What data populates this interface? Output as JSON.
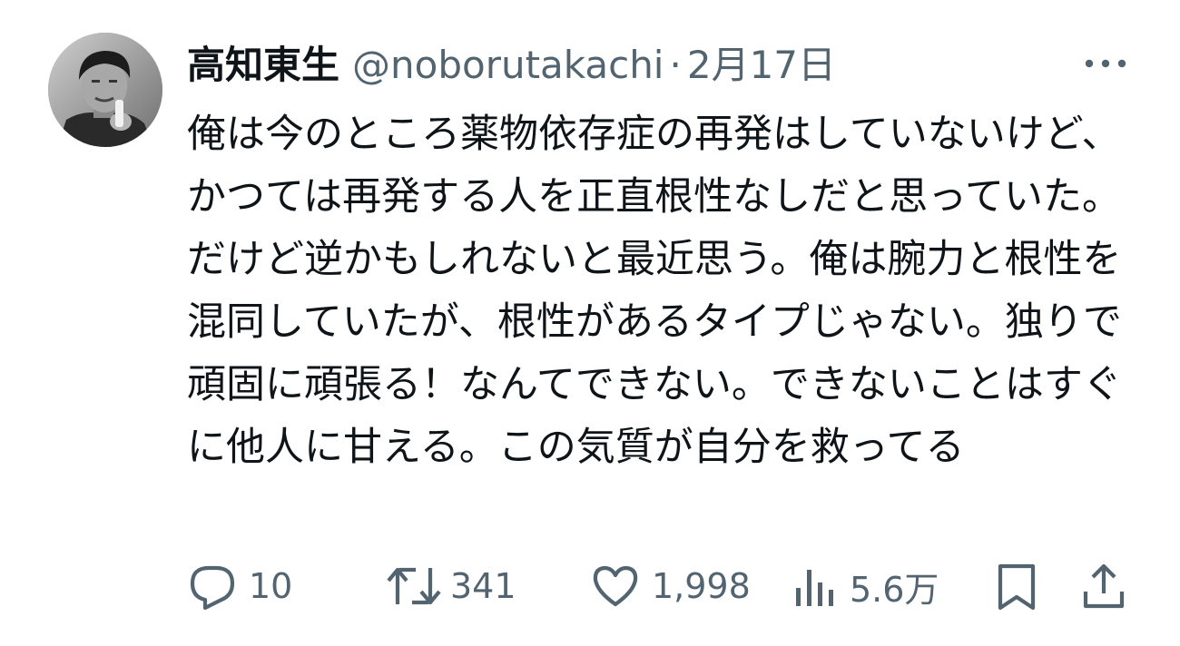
{
  "author": {
    "display_name": "高知東生",
    "handle": "@noborutakachi",
    "separator": "·",
    "timestamp": "2月17日"
  },
  "post": {
    "text": "俺は今のところ薬物依存症の再発はしていないけど、かつては再発する人を正直根性なしだと思っていた。だけど逆かもしれないと最近思う。俺は腕力と根性を混同していたが、根性があるタイプじゃない。独りで頑固に頑張る！なんてできない。できないことはすぐに他人に甘える。この気質が自分を救ってる"
  },
  "actions": {
    "replies": "10",
    "reposts": "341",
    "likes": "1,998",
    "views": "5.6万"
  },
  "icons": {
    "more": "more-horizontal-icon",
    "reply": "reply-bubble-icon",
    "repost": "repost-arrows-icon",
    "like": "heart-icon",
    "views": "bar-chart-icon",
    "bookmark": "bookmark-icon",
    "share": "share-upload-icon"
  },
  "colors": {
    "text_primary": "#0f1419",
    "text_secondary": "#536471"
  }
}
